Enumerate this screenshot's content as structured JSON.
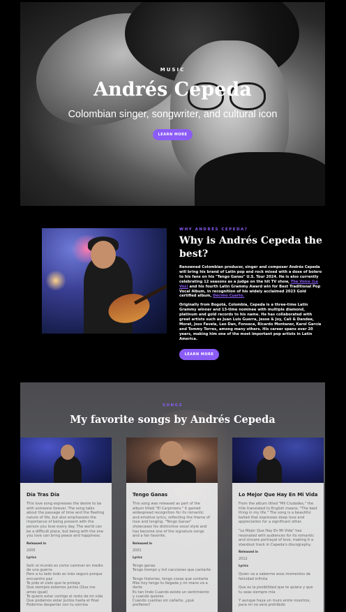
{
  "hero": {
    "eyebrow": "MUSIC",
    "title": "Andrés Cepeda",
    "subtitle": "Colombian singer, songwriter, and cultural icon",
    "button": "LEARN MORE"
  },
  "about": {
    "eyebrow": "WHY ANDRÉS CEPEDA?",
    "heading": "Why is Andrés Cepeda the best?",
    "para1_before": "Renowned Colombian producer, singer and composer Andrés Cepeda will bring his brand of Latin pop and rock mixed with a dose of bolero to his fans on his \"Tengo Ganas\" U.S. Tour 2024. He is also currently celebrating 12 seasons as a judge on the hit TV show, ",
    "para1_link": "The Voice (La Voz)",
    "para1_after": " and his fourth Latin Grammy Award win for Best Traditional Pop Vocal Album, in recognition of his widely acclaimed 2023 Gold certified album, ",
    "para1_link2": "Décimo Cuarto.",
    "para2": "Originally from Bogotá, Colombia, Cepeda is a three-time Latin Grammy winner and 13-time nominee with multiple diamond, platinum and gold records to his name. He has collaborated with great artists such as Juan Luis Guerra, Jesse & Joy, Cali & Dandee, Morat, Joss Favela, Leo Dan, Fonseca, Ricardo Montaner, Karol García and Tommy Torres, among many others. His career spans over 20 years, making him one of the most important pop artists in Latin America.",
    "button": "LEARN MORE"
  },
  "songs": {
    "eyebrow": "SONGS",
    "heading": "My favorite songs by Andrés Cepeda",
    "released_label": "Released in",
    "lyrics_label": "Lyrics",
    "cards": [
      {
        "title": "Día Tras Día",
        "desc": "This love song expresses the desire to be with someone forever. The song talks about the passage of time and the fleeting nature of life, but also emphasizes the importance of being present with the person you love every day. The world can be a difficult place, but being with the one you love can bring peace and happiness.",
        "year": "2005",
        "lyrics": "Salir al mundo es como caminar en medio de una guerra\nPero a tu lado todo es más seguro porque encuentro paz\nTe pido el cielo que te proteja\nQue siempre estemos juntos (Que me ames igual)\nTe quiero estar contigo el resto de mi vida\nQue podamos estar juntos hasta el final\nPoderme despertar con tu sonrisa"
      },
      {
        "title": "Tengo Ganas",
        "desc": "This song was released as part of the album titled \"El Carpintero.\" It gained widespread recognition for its romantic and emotive lyrics, reflecting the theme of love and longing. \"Tengo Ganas\" showcases his distinctive vocal style and has become one of the signature songs and a fan favorite.",
        "year": "2001",
        "lyrics": "Tengo ganas\nTengo tiempo y mil canciones que cantarte\n\nTengo historias, tengo cosas que contarte\nMás hoy tengo tu llegada y mi mano va a darte\nEs tan lindo Cuando existe un sentimiento y cuando quieres\nCuando cuentas sin callarte, ¿qué prefieres?"
      },
      {
        "title": "Lo Mejor Que Hay En Mi Vida",
        "desc": "From the album titled \"Mil Ciudades,\" the title translated to English means, \"The best thing in my life.\" The song is a beautiful ballad that expresses deep love and appreciation for a significant other.",
        "desc2": "\"Lo Mejor Que Hay En Mi Vida\" has resonated with audiences for its romantic and sincere portrayal of love, making it a standout track in Cepeda's discography.",
        "year": "2012",
        "lyrics": "Quien va a saberme esos momentos de felicidad infinita\n\nQue es la posibilidad que te quiera y que tu seas siempre mía\n\nY aunque haya un muro entre nosotros, para mí no será prohibido"
      }
    ]
  }
}
